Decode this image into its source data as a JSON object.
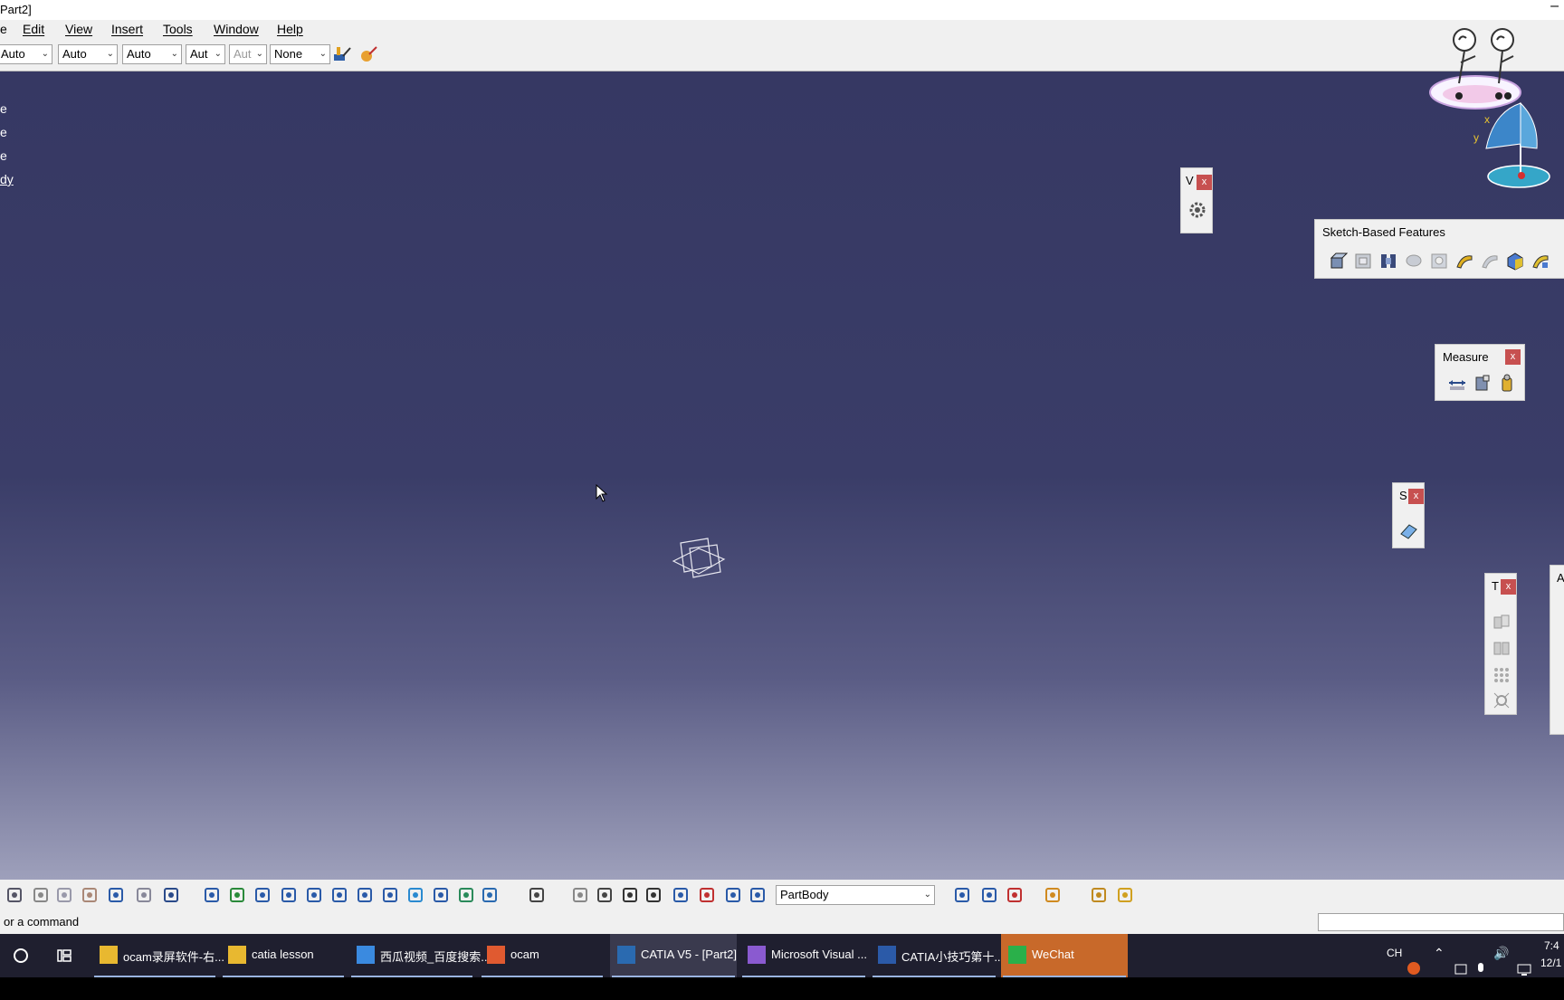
{
  "window": {
    "title": "Part2]",
    "minimize_glyph": "–"
  },
  "menu": [
    "e",
    "Edit",
    "View",
    "Insert",
    "Tools",
    "Window",
    "Help"
  ],
  "top_toolbar": {
    "combos": [
      {
        "value": "Auto",
        "disabled": false
      },
      {
        "value": "Auto",
        "disabled": false
      },
      {
        "value": "Auto",
        "disabled": false
      },
      {
        "value": "Aut",
        "disabled": false
      },
      {
        "value": "Aut",
        "disabled": true
      },
      {
        "value": "None",
        "disabled": false
      }
    ],
    "icons": [
      "painter-format-icon",
      "apply-material-icon"
    ]
  },
  "tree": [
    "e",
    "e",
    "e",
    "dy"
  ],
  "panels": {
    "v": {
      "title": "V",
      "icons": [
        "gear-icon"
      ]
    },
    "sketch_based": {
      "title": "Sketch-Based Features",
      "icons": [
        "pad-icon",
        "pocket-icon",
        "shaft-icon",
        "groove-icon",
        "hole-icon",
        "rib-icon",
        "slot-icon",
        "multi-sections-solid-icon",
        "remove-multi-sections-icon"
      ]
    },
    "measure": {
      "title": "Measure",
      "icons": [
        "measure-between-icon",
        "measure-item-icon",
        "measure-inertia-icon"
      ]
    },
    "s": {
      "title": "S",
      "icons": [
        "surface-based-icon"
      ]
    },
    "t": {
      "title": "T",
      "icons": [
        "translate-icon",
        "mirror-icon",
        "pattern-icon",
        "scale-icon"
      ]
    },
    "a": {
      "title": "A"
    }
  },
  "compass": {
    "x_label": "x",
    "y_label": "y"
  },
  "bottom_toolbar": {
    "body_combo": "PartBody",
    "icons": [
      "print-icon",
      "cut-icon",
      "copy-icon",
      "paste-icon",
      "undo-icon",
      "redo-icon",
      "whats-this-icon",
      "fly-mode-icon",
      "fit-all-icon",
      "pan-icon",
      "rotate-icon",
      "zoom-in-icon",
      "zoom-out-icon",
      "normal-view-icon",
      "multi-view-icon",
      "isometric-view-icon",
      "shading-icon",
      "hide-show-icon",
      "swap-visible-icon",
      "catalog-icon",
      "update-icon",
      "hand-icon",
      "axis-system-icon",
      "measure-inertia-icon",
      "plane-icon",
      "constraint-icon",
      "line-icon",
      "sketch-icon",
      "insert-body-icon",
      "geometrical-set-icon",
      "ordered-set-icon",
      "apply-material-icon",
      "sketcher-icon",
      "positioned-sketch-icon"
    ]
  },
  "status": {
    "text": "or a command"
  },
  "taskbar": {
    "items": [
      {
        "label": "ocam录屏软件-右...",
        "icon": "folder-icon",
        "active": false
      },
      {
        "label": "catia lesson",
        "icon": "folder-icon",
        "active": false
      },
      {
        "label": "西瓜视频_百度搜索...",
        "icon": "sogou-browser-icon",
        "active": false
      },
      {
        "label": "ocam",
        "icon": "ocam-icon",
        "active": false
      },
      {
        "label": "CATIA V5 - [Part2]",
        "icon": "catia-icon",
        "active": true
      },
      {
        "label": "Microsoft Visual ...",
        "icon": "visual-studio-icon",
        "active": false
      },
      {
        "label": "CATIA小技巧第十...",
        "icon": "word-icon",
        "active": false
      },
      {
        "label": "WeChat",
        "icon": "wechat-icon",
        "active": false
      }
    ],
    "lang": "CH",
    "time": "7:4",
    "date": "12/1"
  },
  "colors": {
    "viewport_top": "#363863",
    "viewport_bottom": "#9ea0bb",
    "close_red": "#c75050",
    "wechat_orange": "#c8692a"
  }
}
